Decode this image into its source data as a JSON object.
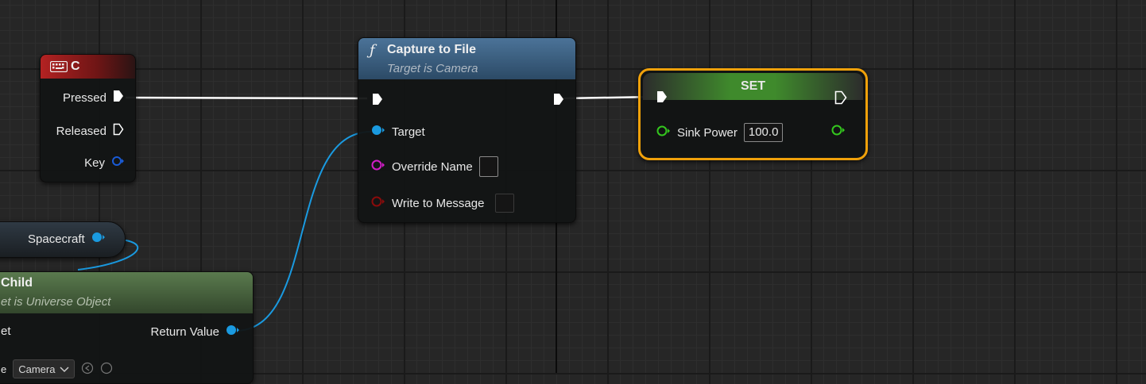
{
  "nodes": {
    "key_event": {
      "title": "C",
      "pins": {
        "pressed": "Pressed",
        "released": "Released",
        "key": "Key"
      }
    },
    "capture": {
      "title": "Capture to File",
      "subtitle": "Target is Camera",
      "pins": {
        "target": "Target",
        "override_name": "Override Name",
        "write_to_message": "Write to Message"
      }
    },
    "set_node": {
      "title": "SET",
      "pins": {
        "sink_power": "Sink Power",
        "sink_power_value": "100.0"
      }
    },
    "spacecraft_var": {
      "label": "Spacecraft"
    },
    "get_child": {
      "title": "Child",
      "subtitle": "et is Universe Object",
      "pins": {
        "target_fragment": "et",
        "return_value": "Return Value",
        "class_prefix": "e",
        "class_value": "Camera"
      }
    }
  },
  "colors": {
    "exec": "#ffffff",
    "object_pin": "#1a9ae0",
    "name_pin": "#d21ec8",
    "message_pin": "#8a0b0b",
    "float_pin": "#34c71e",
    "selection": "#f0a10a"
  }
}
